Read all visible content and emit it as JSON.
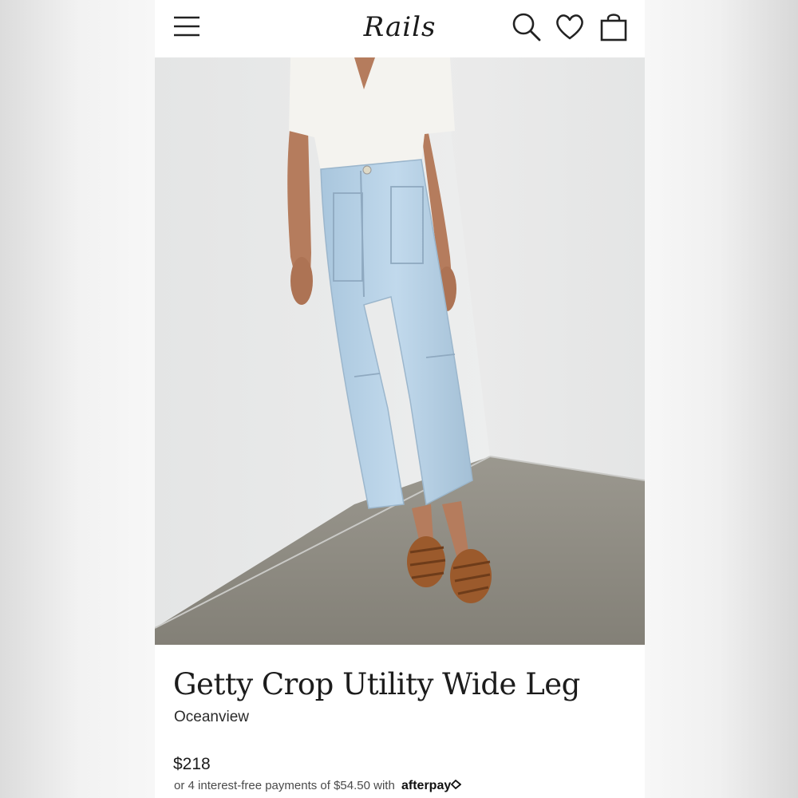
{
  "header": {
    "logo_text": "Rails",
    "icons": [
      "menu-icon",
      "search-icon",
      "heart-icon",
      "bag-icon"
    ]
  },
  "gallery": {
    "image_count": 5,
    "active_index": 0,
    "icons": [
      "product-photo"
    ]
  },
  "product": {
    "title": "Getty Crop Utility Wide Leg",
    "color": "Oceanview",
    "price": "$218",
    "installments_text": "or 4 interest-free payments of $54.50 with",
    "installments_provider": "afterpay"
  },
  "colors": {
    "text": "#1c1c1c",
    "wall": "#e9eaea",
    "floor": "#8a877f",
    "denim": "#b8d3e8"
  }
}
